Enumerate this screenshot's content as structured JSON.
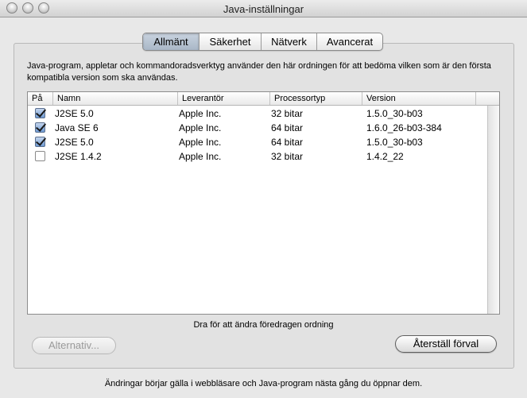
{
  "window": {
    "title": "Java-inställningar",
    "buttons": [
      "close",
      "minimize",
      "zoom"
    ]
  },
  "tabs": [
    {
      "label": "Allmänt",
      "active": true
    },
    {
      "label": "Säkerhet",
      "active": false
    },
    {
      "label": "Nätverk",
      "active": false
    },
    {
      "label": "Avancerat",
      "active": false
    }
  ],
  "description": "Java-program, appletar och kommandoradsverktyg använder den här ordningen för att bedöma vilken som är den första kompatibla version som ska användas.",
  "table": {
    "columns": [
      "På",
      "Namn",
      "Leverantör",
      "Processortyp",
      "Version"
    ],
    "rows": [
      {
        "enabled": true,
        "name": "J2SE 5.0",
        "vendor": "Apple Inc.",
        "processor": "32 bitar",
        "version": "1.5.0_30-b03"
      },
      {
        "enabled": true,
        "name": "Java SE 6",
        "vendor": "Apple Inc.",
        "processor": "64 bitar",
        "version": "1.6.0_26-b03-384"
      },
      {
        "enabled": true,
        "name": "J2SE 5.0",
        "vendor": "Apple Inc.",
        "processor": "64 bitar",
        "version": "1.5.0_30-b03"
      },
      {
        "enabled": false,
        "name": "J2SE 1.4.2",
        "vendor": "Apple Inc.",
        "processor": "32 bitar",
        "version": "1.4.2_22"
      }
    ]
  },
  "hint": "Dra för att ändra föredragen ordning",
  "buttons": {
    "options": "Alternativ...",
    "reset": "Återställ förval"
  },
  "footer": "Ändringar börjar gälla i webbläsare och Java-program nästa gång du öppnar dem."
}
